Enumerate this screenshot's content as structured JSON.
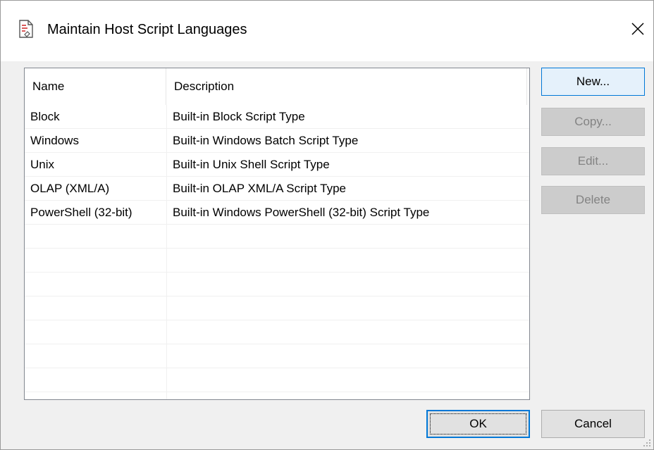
{
  "window": {
    "title": "Maintain Host Script Languages"
  },
  "icons": {
    "title_icon": "document-script-icon",
    "close_icon": "close-icon"
  },
  "list": {
    "columns": [
      "Name",
      "Description"
    ],
    "rows": [
      {
        "name": "Block",
        "description": "Built-in Block Script Type"
      },
      {
        "name": "Windows",
        "description": "Built-in Windows Batch Script Type"
      },
      {
        "name": "Unix",
        "description": "Built-in Unix Shell Script Type"
      },
      {
        "name": "OLAP (XML/A)",
        "description": "Built-in OLAP XML/A Script Type"
      },
      {
        "name": "PowerShell (32-bit)",
        "description": "Built-in Windows PowerShell (32-bit) Script Type"
      }
    ],
    "empty_row_count": 7
  },
  "buttons": {
    "new": "New...",
    "copy": "Copy...",
    "edit": "Edit...",
    "delete": "Delete",
    "ok": "OK",
    "cancel": "Cancel"
  },
  "colors": {
    "accent": "#0078d7",
    "disabled_text": "#838383"
  }
}
